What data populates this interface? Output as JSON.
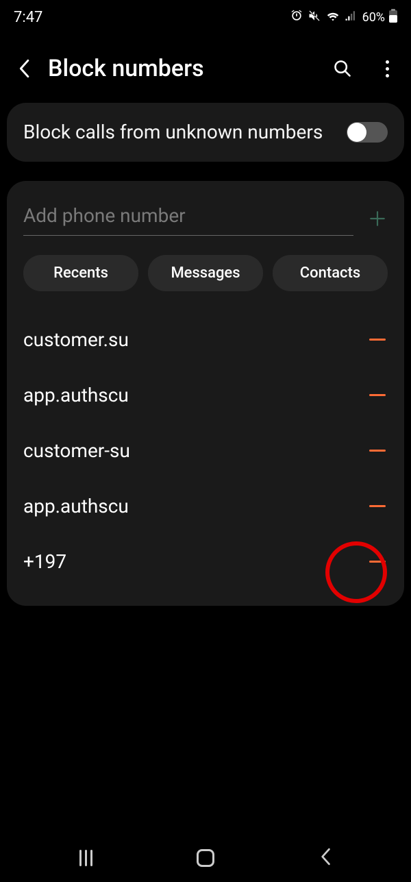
{
  "status": {
    "time": "7:47",
    "battery": "60%"
  },
  "header": {
    "title": "Block numbers"
  },
  "block_unknown": {
    "label": "Block calls from unknown numbers",
    "enabled": false
  },
  "input": {
    "placeholder": "Add phone number"
  },
  "chips": [
    {
      "label": "Recents"
    },
    {
      "label": "Messages"
    },
    {
      "label": "Contacts"
    }
  ],
  "blocked": [
    {
      "name": "customer.su"
    },
    {
      "name": "app.authscu"
    },
    {
      "name": "customer-su"
    },
    {
      "name": "app.authscu"
    },
    {
      "name": "+197"
    }
  ]
}
